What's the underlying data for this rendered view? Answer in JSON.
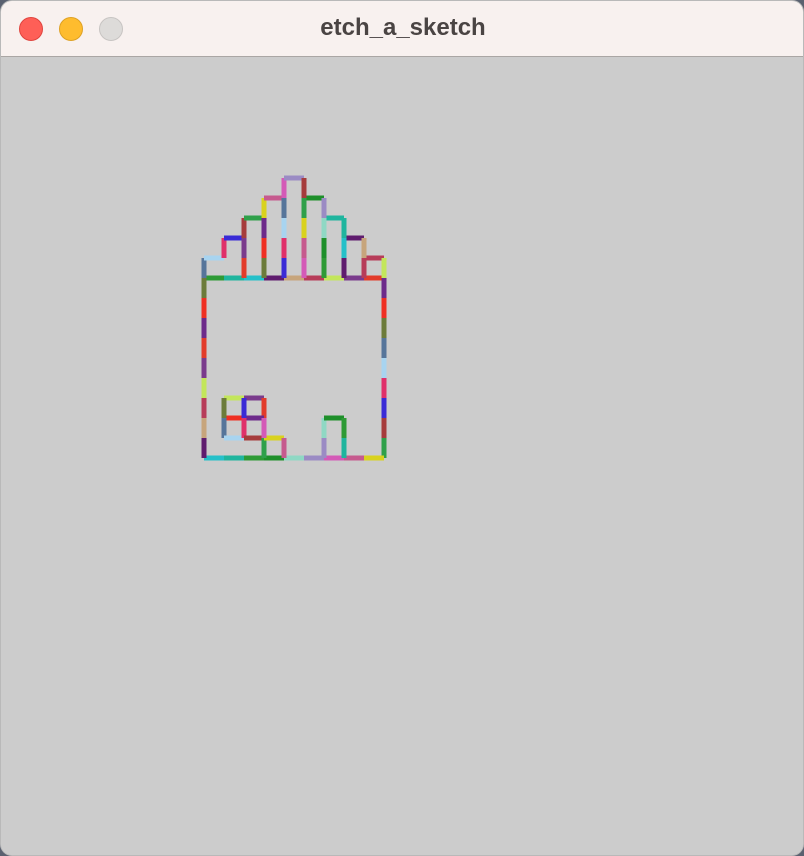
{
  "window": {
    "title": "etch_a_sketch"
  },
  "colors": {
    "canvas_background": "#cccccc",
    "titlebar_background": "#f8f1ef",
    "close": "#fe5f57",
    "minimize": "#febc2e",
    "zoom": "#dddbd9"
  },
  "icons": [
    "close-icon",
    "minimize-icon",
    "zoom-icon"
  ]
}
